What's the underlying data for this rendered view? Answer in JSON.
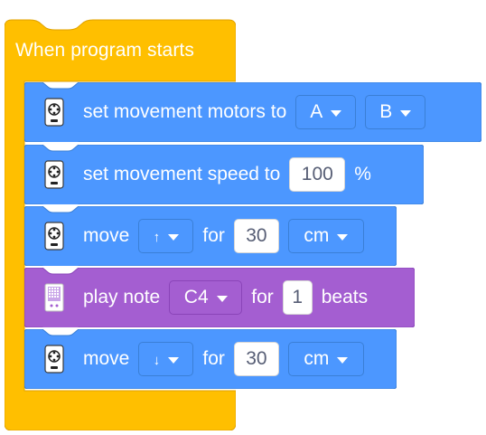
{
  "hat": {
    "label": "When program starts",
    "color": "#ffbf00"
  },
  "colors": {
    "motion_blue": "#4c97ff",
    "sound_purple": "#a45ed1",
    "input_white": "#ffffff"
  },
  "blocks": [
    {
      "icon": "movement-hub-icon",
      "text": "set movement motors to",
      "dropdown1": "A",
      "dropdown2": "B"
    },
    {
      "icon": "movement-hub-icon",
      "text": "set movement speed to",
      "value": "100",
      "unit": "%"
    },
    {
      "icon": "movement-hub-icon",
      "text": "move",
      "direction": "↑",
      "for_text": "for",
      "value": "30",
      "unit": "cm"
    },
    {
      "icon": "light-matrix-icon",
      "text": "play note",
      "note": "C4",
      "for_text": "for",
      "value": "1",
      "unit": "beats"
    },
    {
      "icon": "movement-hub-icon",
      "text": "move",
      "direction": "↓",
      "for_text": "for",
      "value": "30",
      "unit": "cm"
    }
  ]
}
